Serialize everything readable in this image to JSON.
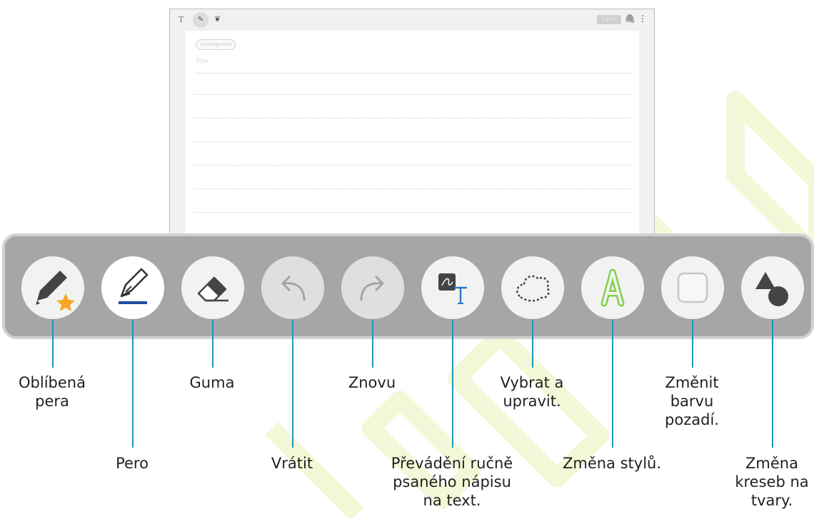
{
  "note": {
    "toolbar": {
      "text_mode_label": "T",
      "save_label": "Save"
    },
    "category_placeholder": "Uncategorised",
    "title_placeholder": "Title"
  },
  "colors": {
    "panel": "#a6a6a6",
    "panel_border": "#d1d1d1",
    "callout": "#1e93bd",
    "pen_underline": "#1f4e9c",
    "star": "#f6a623",
    "style_green": "#7fd14a",
    "watermark": "#f4f8d8"
  },
  "tools": [
    {
      "name": "Oblíbená pera",
      "icon": "favorite-pens-icon"
    },
    {
      "name": "Pero",
      "icon": "pen-icon"
    },
    {
      "name": "Guma",
      "icon": "eraser-icon"
    },
    {
      "name": "Vrátit",
      "icon": "undo-icon"
    },
    {
      "name": "Znovu",
      "icon": "redo-icon"
    },
    {
      "name": "Převádění ručně psaného nápisu na text.",
      "icon": "handwriting-to-text-icon"
    },
    {
      "name": "Vybrat a upravit.",
      "icon": "select-edit-icon"
    },
    {
      "name": "Změna stylů.",
      "icon": "change-style-icon"
    },
    {
      "name": "Změnit barvu pozadí.",
      "icon": "background-color-icon"
    },
    {
      "name": "Změna kreseb na tvary.",
      "icon": "shapes-icon"
    }
  ],
  "labels": {
    "favorite_pens": [
      "Oblíbená",
      "pera"
    ],
    "pen": [
      "Pero"
    ],
    "eraser": [
      "Guma"
    ],
    "undo": [
      "Vrátit"
    ],
    "redo": [
      "Znovu"
    ],
    "handwriting_to_text": [
      "Převádění ručně",
      "psaného nápisu",
      "na text."
    ],
    "select_edit": [
      "Vybrat a",
      "upravit."
    ],
    "change_style": [
      "Změna stylů."
    ],
    "background_color": [
      "Změnit",
      "barvu",
      "pozadí."
    ],
    "shapes": [
      "Změna",
      "kreseb na",
      "tvary."
    ]
  }
}
